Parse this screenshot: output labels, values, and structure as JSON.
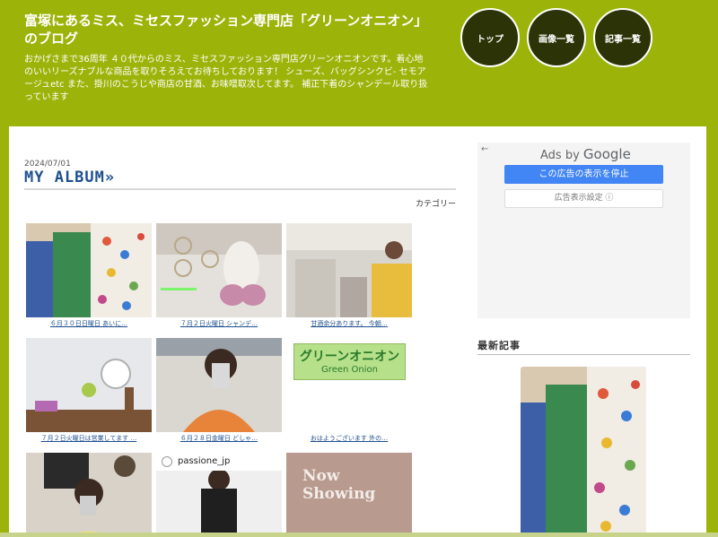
{
  "header": {
    "title": "富塚にあるミス、ミセスファッション専門店「グリーンオニオン」のブログ",
    "description": "おかげさまで36周年 ４０代からのミス、ミセスファッション専門店グリーンオニオンです。着心地のいいリーズナブルな商品を取りそろえてお待ちしております！ シューズ、バッグシンクビ- セモアージュetc また、掛川のこうじや商店の甘酒、お味噌取次してます。 補正下着のシャンデール取り扱っています"
  },
  "nav": {
    "top": "トップ",
    "images": "画像一覧",
    "articles": "記事一覧"
  },
  "post": {
    "date": "2024/07/01",
    "title": "MY ALBUM»",
    "category": "カテゴリー"
  },
  "album": {
    "items": [
      {
        "caption": "６月３０日日曜日 あいに…"
      },
      {
        "caption": "７月２日火曜日 シャンデ…"
      },
      {
        "caption": "甘酒余分あります。 今朝…"
      },
      {
        "caption": "７月２日火曜日は営業してます …"
      },
      {
        "caption": "６月２８日金曜日 どしゃ…"
      },
      {
        "caption": "おはようございます 外の…"
      },
      {
        "caption": ""
      },
      {
        "caption": ""
      },
      {
        "caption": ""
      }
    ],
    "logo_text_jp": "グリーンオニオン",
    "logo_text_en": "Green Onion",
    "insta_handle": "passione_jp",
    "now_showing_1": "Now",
    "now_showing_2": "Showing"
  },
  "ads": {
    "back_arrow": "←",
    "ads_by": "Ads by",
    "google": "Google",
    "stop_label": "この広告の表示を停止",
    "settings_label": "広告表示設定 ⓘ"
  },
  "sidebar": {
    "recent_title": "最新記事"
  },
  "colors": {
    "brand_green": "#9cb40a",
    "nav_dark": "#2c3306",
    "link_blue": "#1e4f8f",
    "google_blue": "#4285f4"
  }
}
